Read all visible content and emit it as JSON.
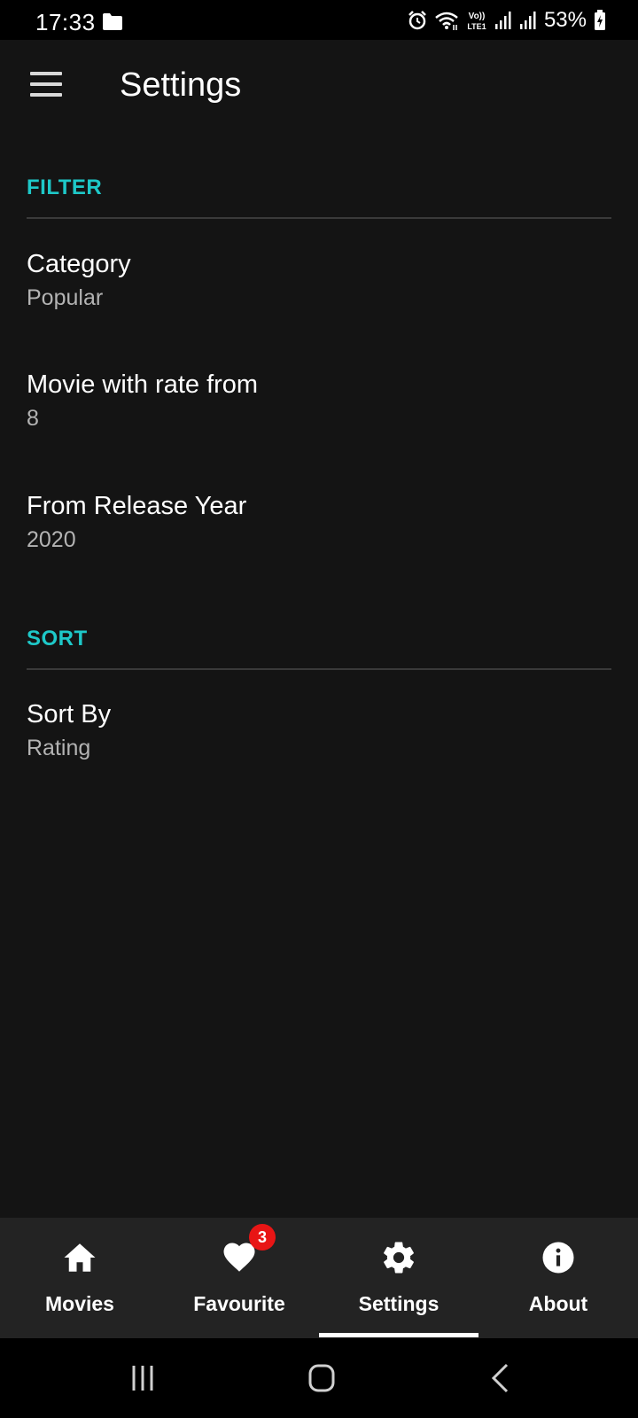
{
  "status_bar": {
    "time": "17:33",
    "network_label": "Vo)) LTE1",
    "battery": "53%",
    "icons": [
      "folder-icon",
      "alarm-icon",
      "wifi-icon",
      "volte-icon",
      "signal-icon",
      "signal-icon",
      "battery-charging-icon"
    ]
  },
  "app_bar": {
    "title": "Settings",
    "menu_icon": "menu-icon"
  },
  "sections": {
    "filter": {
      "header": "FILTER",
      "items": [
        {
          "title": "Category",
          "value": "Popular"
        },
        {
          "title": "Movie with rate from",
          "value": "8"
        },
        {
          "title": "From Release Year",
          "value": "2020"
        }
      ]
    },
    "sort": {
      "header": "SORT",
      "items": [
        {
          "title": "Sort By",
          "value": "Rating"
        }
      ]
    }
  },
  "bottom_nav": {
    "tabs": [
      {
        "label": "Movies",
        "icon": "home-icon"
      },
      {
        "label": "Favourite",
        "icon": "heart-icon",
        "badge": "3"
      },
      {
        "label": "Settings",
        "icon": "gear-icon",
        "selected": true
      },
      {
        "label": "About",
        "icon": "info-icon"
      }
    ]
  },
  "system_nav": {
    "buttons": [
      "recent-apps-icon",
      "home-circle-icon",
      "back-icon"
    ]
  },
  "colors": {
    "background": "#141414",
    "accent": "#1ec8c8",
    "bottom_nav": "#232323",
    "badge": "#e81515",
    "secondary_text": "#b3b3b3"
  }
}
